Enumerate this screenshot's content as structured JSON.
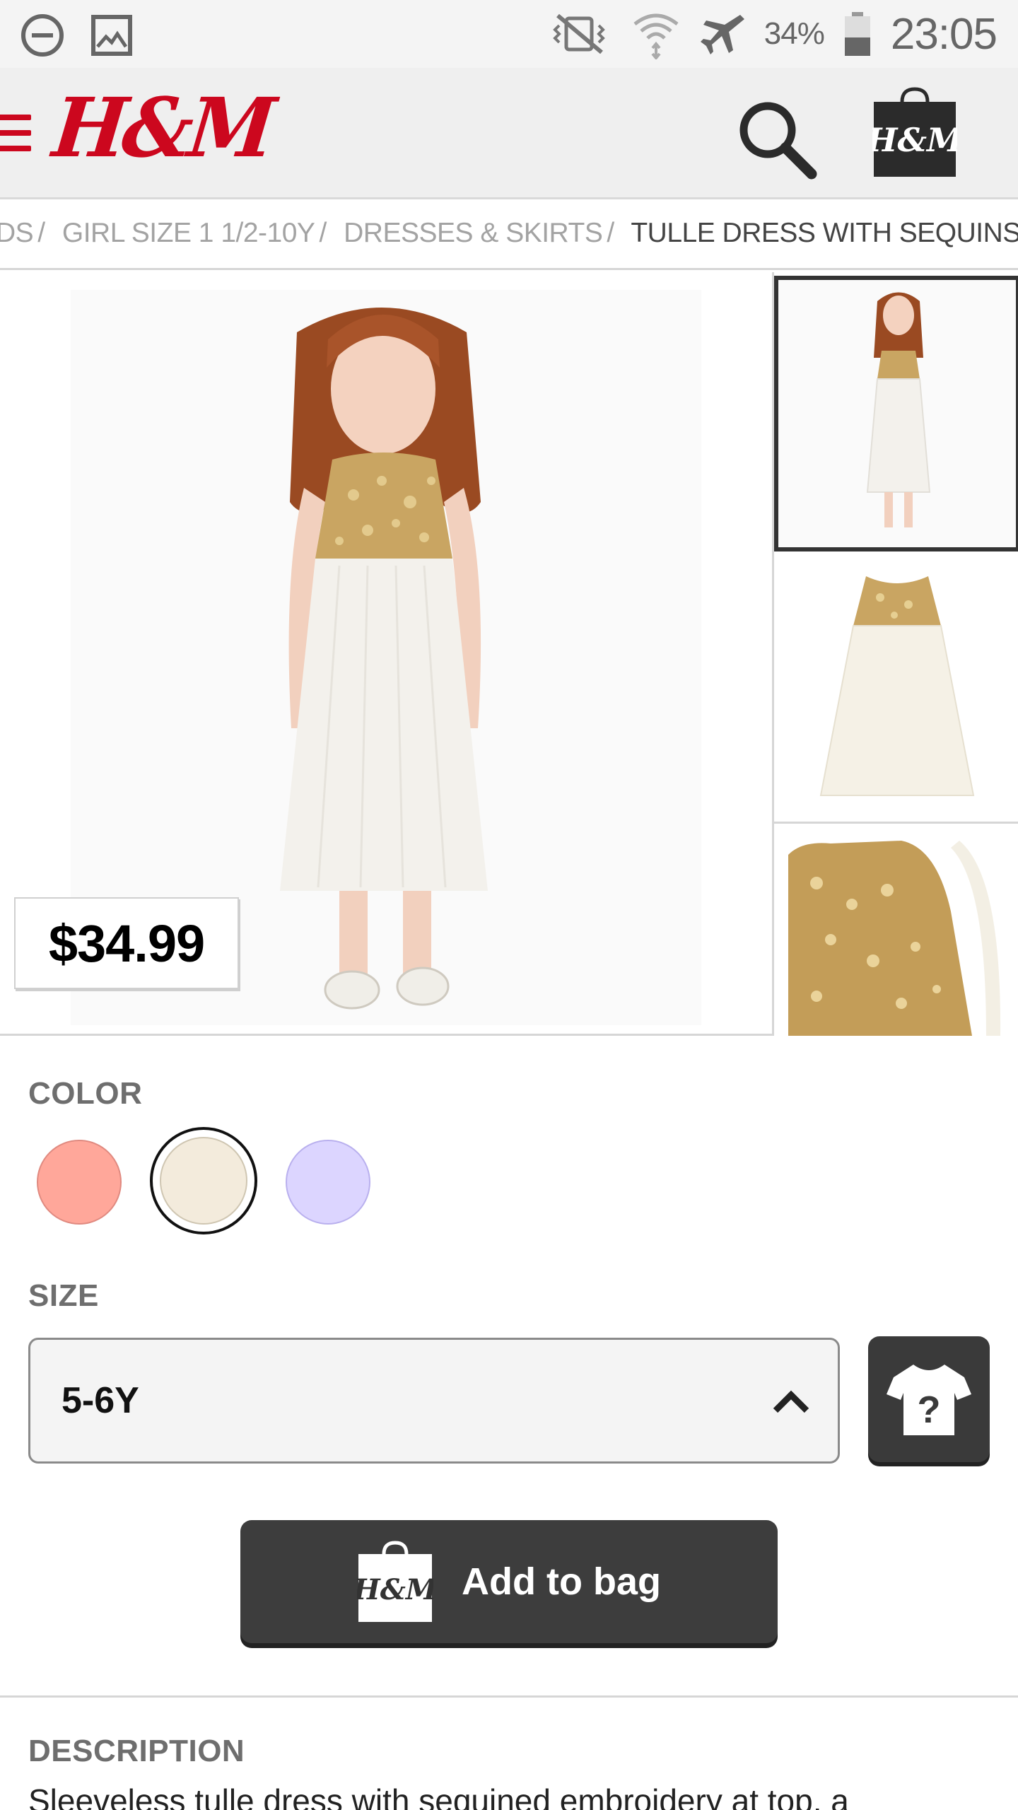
{
  "status_bar": {
    "battery_percent": "34%",
    "time": "23:05",
    "icons": [
      "do-not-disturb-icon",
      "image-icon",
      "vibrate-icon",
      "wifi-icon",
      "airplane-icon",
      "battery-icon"
    ]
  },
  "header": {
    "logo_text": "H&M",
    "brand_color": "#cc071e",
    "bag_logo_text": "H&M"
  },
  "breadcrumb": {
    "items": [
      "DS",
      "GIRL SIZE 1 1/2-10Y",
      "DRESSES & SKIRTS"
    ],
    "separator": "/",
    "current": "TULLE DRESS WITH SEQUINS"
  },
  "product": {
    "price": "$34.99"
  },
  "color": {
    "label": "COLOR",
    "swatches": [
      "#ffa79a",
      "#f3ebdc",
      "#dcd5ff"
    ],
    "selected_index": 1
  },
  "size": {
    "label": "SIZE",
    "selected": "5-6Y"
  },
  "add_to_bag": {
    "label": "Add to bag",
    "icon_text": "H&M"
  },
  "description": {
    "label": "DESCRIPTION",
    "text": "Sleeveless tulle dress with sequined embroidery at top, a"
  }
}
